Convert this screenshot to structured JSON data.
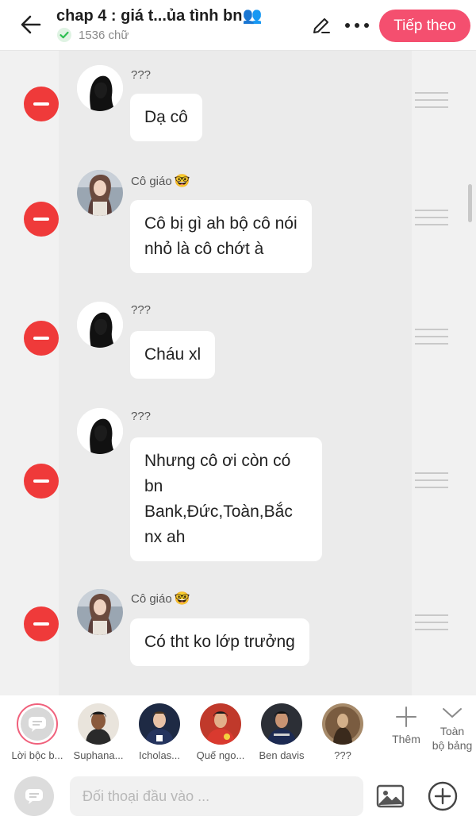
{
  "header": {
    "title": "chap 4 : giá t...ủa tình bn",
    "title_emoji": "👥",
    "word_count": "1536 chữ",
    "next_label": "Tiếp theo",
    "accent_color": "#f44f6f"
  },
  "messages": [
    {
      "name": "???",
      "name_emoji": "",
      "avatar": "silhouette",
      "lines": [
        "Dạ cô"
      ]
    },
    {
      "name": "Cô giáo",
      "name_emoji": "🤓",
      "avatar": "teacher",
      "lines": [
        "Cô bị gì ah bộ cô nói",
        "nhỏ là cô chớt à"
      ]
    },
    {
      "name": "???",
      "name_emoji": "",
      "avatar": "silhouette",
      "lines": [
        "Cháu xl"
      ]
    },
    {
      "name": "???",
      "name_emoji": "",
      "avatar": "silhouette",
      "lines": [
        "Nhưng cô ơi còn có",
        "bn",
        "Bank,Đức,Toàn,Bắc",
        "nx ah"
      ]
    },
    {
      "name": "Cô giáo",
      "name_emoji": "🤓",
      "avatar": "teacher",
      "lines": [
        "Có tht ko lớp trưởng"
      ]
    }
  ],
  "characters": [
    {
      "label": "Lời bộc b...",
      "kind": "narrator"
    },
    {
      "label": "Suphana...",
      "kind": "person"
    },
    {
      "label": "Icholas...",
      "kind": "person"
    },
    {
      "label": "Quế ngo...",
      "kind": "person"
    },
    {
      "label": "Ben davis",
      "kind": "person"
    },
    {
      "label": "???",
      "kind": "person"
    }
  ],
  "tools": {
    "more_label": "Thêm",
    "all_label_1": "Toàn",
    "all_label_2": "bộ bảng"
  },
  "input": {
    "placeholder": "Đối thoại đầu vào ..."
  },
  "colors": {
    "delete": "#ef3a3a",
    "bubble": "#ffffff",
    "background": "#f1f1f1"
  }
}
